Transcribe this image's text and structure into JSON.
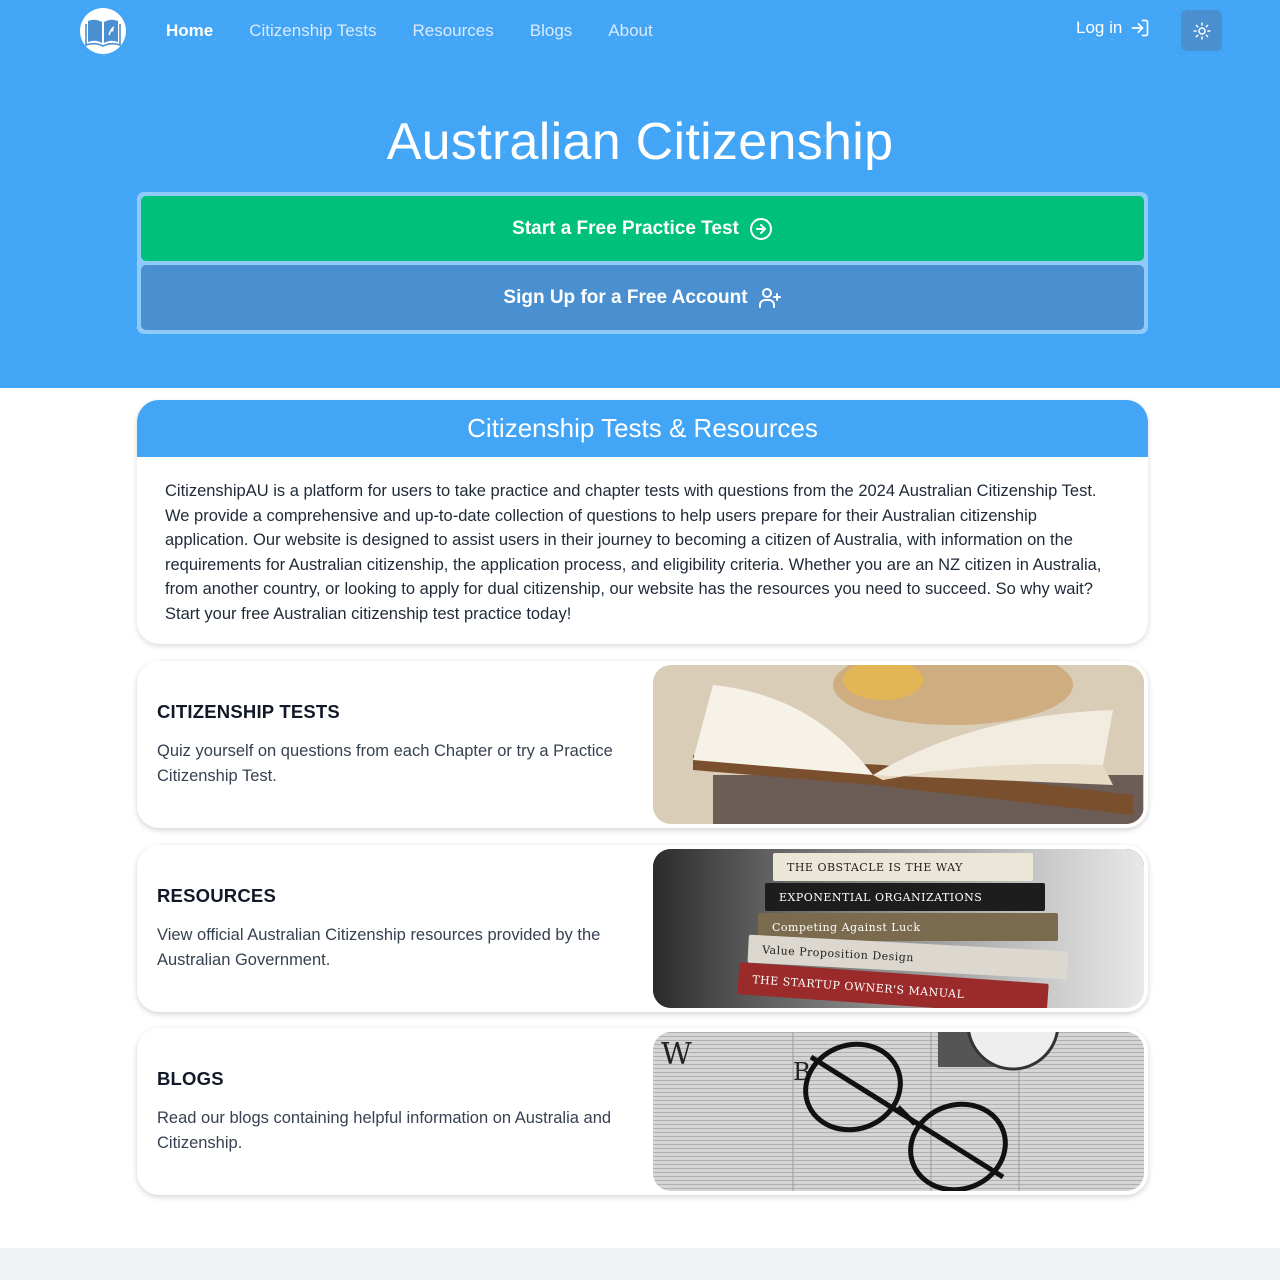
{
  "nav": {
    "logo_alt": "CitizenshipAU logo",
    "links": [
      {
        "label": "Home",
        "active": true
      },
      {
        "label": "Citizenship Tests",
        "active": false
      },
      {
        "label": "Resources",
        "active": false
      },
      {
        "label": "Blogs",
        "active": false
      },
      {
        "label": "About",
        "active": false
      }
    ],
    "login_label": "Log in",
    "theme_toggle_icon": "sun-icon"
  },
  "hero": {
    "title": "Australian Citizenship",
    "primary_cta": {
      "label": "Start a Free Practice Test",
      "icon": "arrow-right-circle-icon"
    },
    "secondary_cta": {
      "label": "Sign Up for a Free Account",
      "icon": "user-plus-icon"
    }
  },
  "intro": {
    "heading": "Citizenship Tests & Resources",
    "body": "CitizenshipAU is a platform for users to take practice and chapter tests with questions from the 2024 Australian Citizenship Test. We provide a comprehensive and up-to-date collection of questions to help users prepare for their Australian citizenship application. Our website is designed to assist users in their journey to becoming a citizen of Australia, with information on the requirements for Australian citizenship, the application process, and eligibility criteria. Whether you are an NZ citizen in Australia, from another country, or looking to apply for dual citizenship, our website has the resources you need to succeed. So why wait? Start your free Australian citizenship test practice today!"
  },
  "features": [
    {
      "title": "CITIZENSHIP TESTS",
      "description": "Quiz yourself on questions from each Chapter or try a Practice Citizenship Test.",
      "image": "open-book-photo"
    },
    {
      "title": "RESOURCES",
      "description": "View official Australian Citizenship resources provided by the Australian Government.",
      "image": "book-stack-photo"
    },
    {
      "title": "BLOGS",
      "description": "Read our blogs containing helpful information on Australia and Citizenship.",
      "image": "newspaper-glasses-photo"
    }
  ],
  "book_stack_titles": [
    "THE OBSTACLE IS THE WAY",
    "EXPONENTIAL ORGANIZATIONS",
    "Competing Against Luck",
    "Value Proposition Design",
    "THE STARTUP OWNER'S MANUAL"
  ],
  "colors": {
    "brand_blue": "#42a5f5",
    "cta_green": "#00c17c",
    "cta_blue": "#4a90d0"
  }
}
